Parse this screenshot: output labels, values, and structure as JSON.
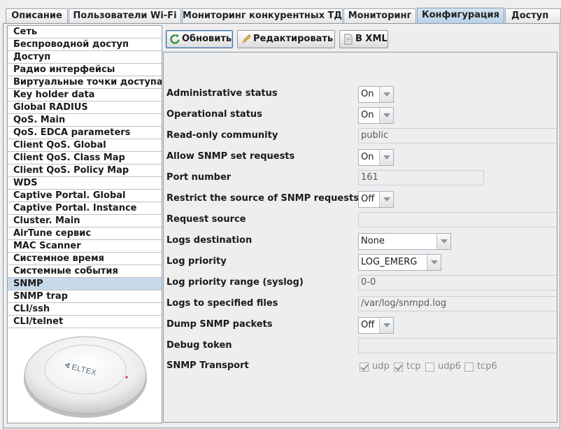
{
  "tabs": [
    {
      "label": "Описание"
    },
    {
      "label": "Пользователи Wi-Fi"
    },
    {
      "label": "Мониторинг конкурентных ТД"
    },
    {
      "label": "Мониторинг"
    },
    {
      "label": "Конфигурация"
    },
    {
      "label": "Доступ"
    }
  ],
  "active_tab": "Конфигурация",
  "sidebar": {
    "items": [
      {
        "label": "Сеть"
      },
      {
        "label": "Беспроводной доступ"
      },
      {
        "label": "Доступ"
      },
      {
        "label": "Радио интерфейсы"
      },
      {
        "label": "Виртуальные точки доступа"
      },
      {
        "label": "Key holder data"
      },
      {
        "label": "Global RADIUS"
      },
      {
        "label": "QoS. Main"
      },
      {
        "label": "QoS. EDCA parameters"
      },
      {
        "label": "Client QoS. Global"
      },
      {
        "label": "Client QoS. Class Map"
      },
      {
        "label": "Client QoS. Policy Map"
      },
      {
        "label": "WDS"
      },
      {
        "label": "Captive Portal. Global"
      },
      {
        "label": "Captive Portal. Instance"
      },
      {
        "label": "Cluster. Main"
      },
      {
        "label": "AirTune сервис"
      },
      {
        "label": "MAC Scanner"
      },
      {
        "label": "Системное время"
      },
      {
        "label": "Системные события"
      },
      {
        "label": "SNMP"
      },
      {
        "label": "SNMP trap"
      },
      {
        "label": "CLI/ssh"
      },
      {
        "label": "CLI/telnet"
      }
    ],
    "selected": "SNMP",
    "device_logo": "ELTEX"
  },
  "toolbar": {
    "refresh_label": "Обновить",
    "edit_label": "Редактировать",
    "xml_label": "В XML"
  },
  "form": {
    "admin_status": {
      "label": "Administrative status",
      "value": "On"
    },
    "oper_status": {
      "label": "Operational status",
      "value": "On"
    },
    "ro_community": {
      "label": "Read-only community",
      "value": "public"
    },
    "allow_set": {
      "label": "Allow SNMP set requests",
      "value": "On"
    },
    "port": {
      "label": "Port number",
      "value": "161"
    },
    "restrict": {
      "label": "Restrict the source of SNMP requests",
      "value": "Off"
    },
    "req_source": {
      "label": "Request source",
      "value": ""
    },
    "logs_dest": {
      "label": "Logs destination",
      "value": "None"
    },
    "log_priority": {
      "label": "Log priority",
      "value": "LOG_EMERG"
    },
    "log_range": {
      "label": "Log priority range (syslog)",
      "value": "0-0"
    },
    "log_files": {
      "label": "Logs to specified files",
      "value": "/var/log/snmpd.log"
    },
    "dump": {
      "label": "Dump SNMP packets",
      "value": "Off"
    },
    "debug": {
      "label": "Debug token",
      "value": ""
    },
    "transport": {
      "label": "SNMP Transport",
      "options": [
        {
          "label": "udp",
          "checked": true
        },
        {
          "label": "tcp",
          "checked": true
        },
        {
          "label": "udp6",
          "checked": false
        },
        {
          "label": "tcp6",
          "checked": false
        }
      ]
    }
  },
  "colors": {
    "selection": "#c8d9ea",
    "active_tab": "#b9d1e8",
    "border": "#8e9aa6"
  }
}
